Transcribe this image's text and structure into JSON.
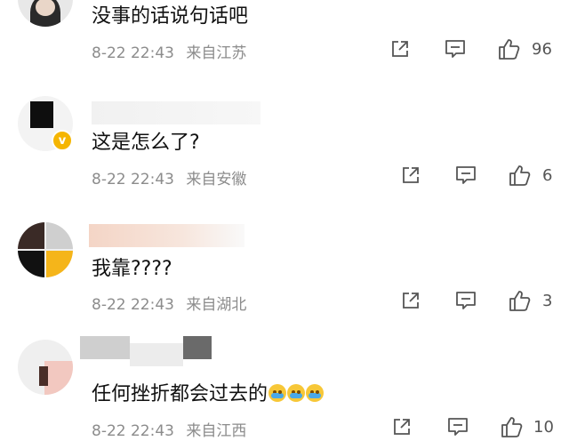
{
  "comments": [
    {
      "text": "没事的话说句话吧",
      "time": "8-22 22:43",
      "location": "来自江苏",
      "likes": "96"
    },
    {
      "text": "这是怎么了?",
      "time": "8-22 22:43",
      "location": "来自安徽",
      "likes": "6",
      "verified_mark": "v"
    },
    {
      "text": "我靠????",
      "time": "8-22 22:43",
      "location": "来自湖北",
      "likes": "3"
    },
    {
      "text": "任何挫折都会过去的",
      "time": "8-22 22:43",
      "location": "来自江西",
      "likes": "10",
      "emoji": [
        "crying-face",
        "crying-face",
        "crying-face"
      ]
    }
  ],
  "icons": {
    "share": "share-icon",
    "comment": "comment-icon",
    "like": "thumbs-up-icon"
  },
  "colors": {
    "text": "#111111",
    "meta": "#8c8c8c",
    "icon": "#555555",
    "verified": "#f5b500"
  }
}
